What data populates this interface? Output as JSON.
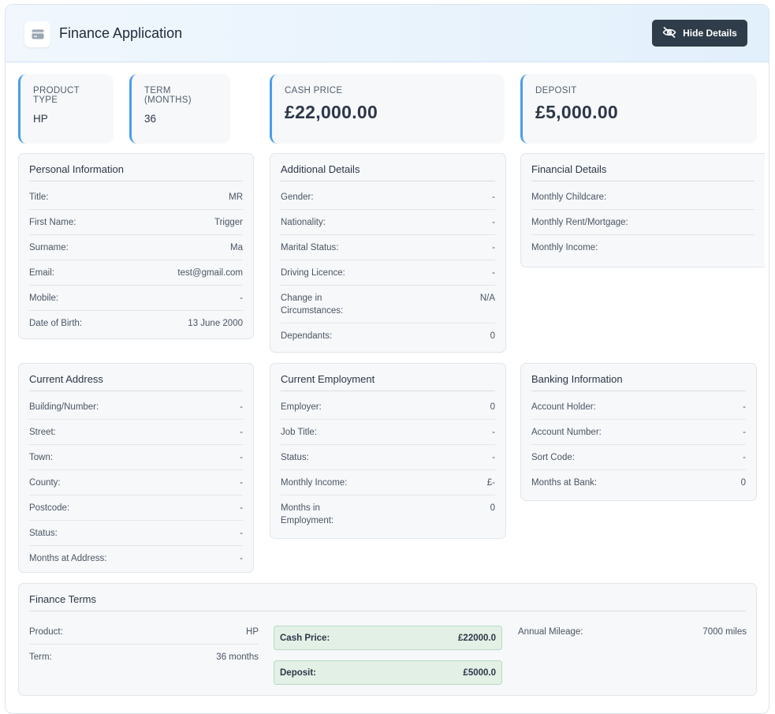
{
  "header": {
    "title": "Finance Application",
    "hide_button": "Hide Details"
  },
  "stats": [
    {
      "label": "PRODUCT TYPE",
      "value": "HP"
    },
    {
      "label": "TERM (MONTHS)",
      "value": "36"
    },
    {
      "label": "CASH PRICE",
      "value": "£22,000.00"
    },
    {
      "label": "DEPOSIT",
      "value": "£5,000.00"
    }
  ],
  "personal": {
    "title": "Personal Information",
    "rows": [
      {
        "k": "Title:",
        "v": "MR"
      },
      {
        "k": "First Name:",
        "v": "Trigger"
      },
      {
        "k": "Surname:",
        "v": "Ma"
      },
      {
        "k": "Email:",
        "v": "test@gmail.com"
      },
      {
        "k": "Mobile:",
        "v": "-"
      },
      {
        "k": "Date of Birth:",
        "v": "13 June 2000"
      }
    ]
  },
  "additional": {
    "title": "Additional Details",
    "rows": [
      {
        "k": "Gender:",
        "v": "-"
      },
      {
        "k": "Nationality:",
        "v": "-"
      },
      {
        "k": "Marital Status:",
        "v": "-"
      },
      {
        "k": "Driving Licence:",
        "v": "-"
      },
      {
        "k": "Change in Circumstances:",
        "v": "N/A"
      },
      {
        "k": "Dependants:",
        "v": "0"
      }
    ]
  },
  "financial": {
    "title": "Financial Details",
    "rows": [
      {
        "k": "Monthly Childcare:",
        "v": ""
      },
      {
        "k": "Monthly Rent/Mortgage:",
        "v": ""
      },
      {
        "k": "Monthly Income:",
        "v": ""
      }
    ]
  },
  "address": {
    "title": "Current Address",
    "rows": [
      {
        "k": "Building/Number:",
        "v": "-"
      },
      {
        "k": "Street:",
        "v": "-"
      },
      {
        "k": "Town:",
        "v": "-"
      },
      {
        "k": "County:",
        "v": "-"
      },
      {
        "k": "Postcode:",
        "v": "-"
      },
      {
        "k": "Status:",
        "v": "-"
      },
      {
        "k": "Months at Address:",
        "v": "-"
      }
    ]
  },
  "employment": {
    "title": "Current Employment",
    "rows": [
      {
        "k": "Employer:",
        "v": "0"
      },
      {
        "k": "Job Title:",
        "v": "-"
      },
      {
        "k": "Status:",
        "v": "-"
      },
      {
        "k": "Monthly Income:",
        "v": "£-"
      },
      {
        "k": "Months in Employment:",
        "v": "0"
      }
    ]
  },
  "banking": {
    "title": "Banking Information",
    "rows": [
      {
        "k": "Account Holder:",
        "v": "-"
      },
      {
        "k": "Account Number:",
        "v": "-"
      },
      {
        "k": "Sort Code:",
        "v": "-"
      },
      {
        "k": "Months at Bank:",
        "v": "0"
      }
    ]
  },
  "terms": {
    "title": "Finance Terms",
    "rows": [
      {
        "k": "Product:",
        "v": "HP"
      },
      {
        "k": "Term:",
        "v": "36 months"
      }
    ],
    "cash_price_label": "Cash Price:",
    "cash_price_value": "£22000.0",
    "deposit_label": "Deposit:",
    "deposit_value": "£5000.0",
    "mileage_label": "Annual Mileage:",
    "mileage_value": "7000 miles"
  }
}
